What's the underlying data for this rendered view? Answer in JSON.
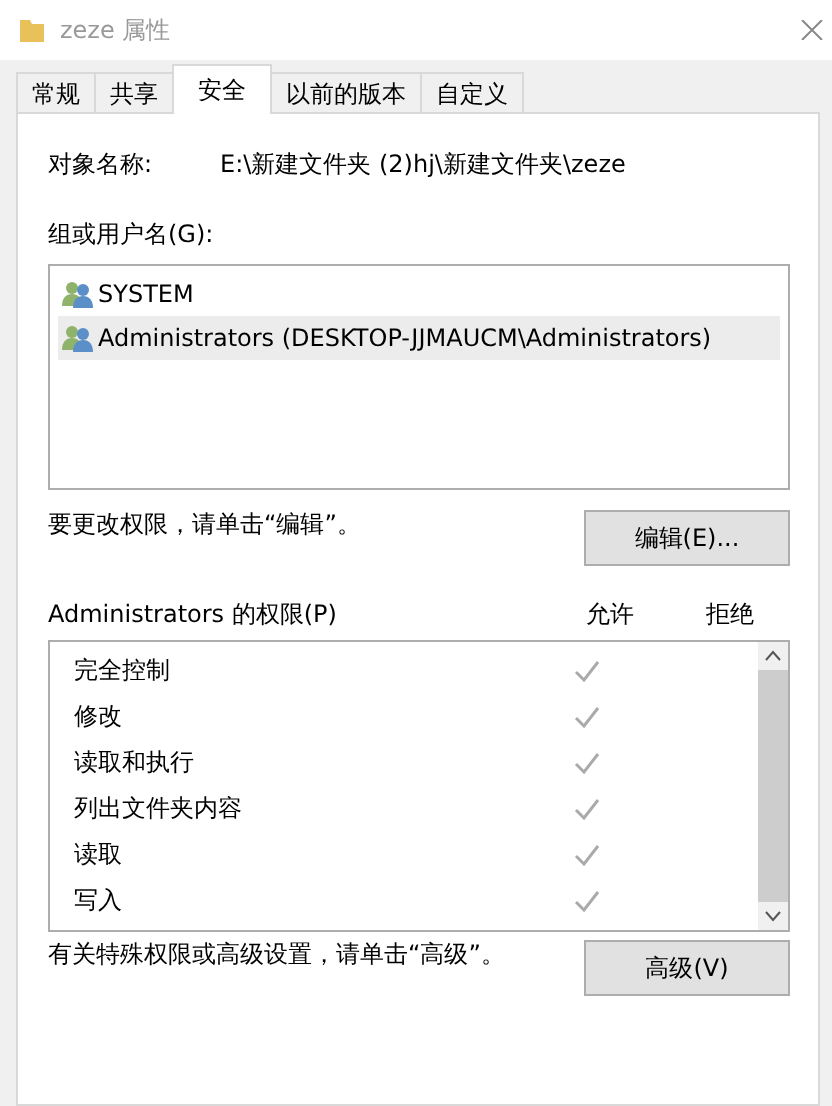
{
  "window": {
    "title": "zeze 属性"
  },
  "tabs": [
    {
      "label": "常规",
      "selected": false
    },
    {
      "label": "共享",
      "selected": false
    },
    {
      "label": "安全",
      "selected": true
    },
    {
      "label": "以前的版本",
      "selected": false
    },
    {
      "label": "自定义",
      "selected": false
    }
  ],
  "object_name": {
    "label": "对象名称:",
    "value": "E:\\新建文件夹 (2)hj\\新建文件夹\\zeze"
  },
  "users": {
    "label": "组或用户名(G):",
    "items": [
      {
        "name": "SYSTEM",
        "selected": false
      },
      {
        "name": "Administrators (DESKTOP-JJMAUCM\\Administrators)",
        "selected": true
      }
    ]
  },
  "edit_hint": "要更改权限，请单击“编辑”。",
  "edit_button": "编辑(E)...",
  "permissions": {
    "title": "Administrators 的权限(P)",
    "allow_header": "允许",
    "deny_header": "拒绝",
    "rows": [
      {
        "name": "完全控制",
        "allow": true,
        "deny": false
      },
      {
        "name": "修改",
        "allow": true,
        "deny": false
      },
      {
        "name": "读取和执行",
        "allow": true,
        "deny": false
      },
      {
        "name": "列出文件夹内容",
        "allow": true,
        "deny": false
      },
      {
        "name": "读取",
        "allow": true,
        "deny": false
      },
      {
        "name": "写入",
        "allow": true,
        "deny": false
      }
    ]
  },
  "advanced_hint": "有关特殊权限或高级设置，请单击“高级”。",
  "advanced_button": "高级(V)"
}
